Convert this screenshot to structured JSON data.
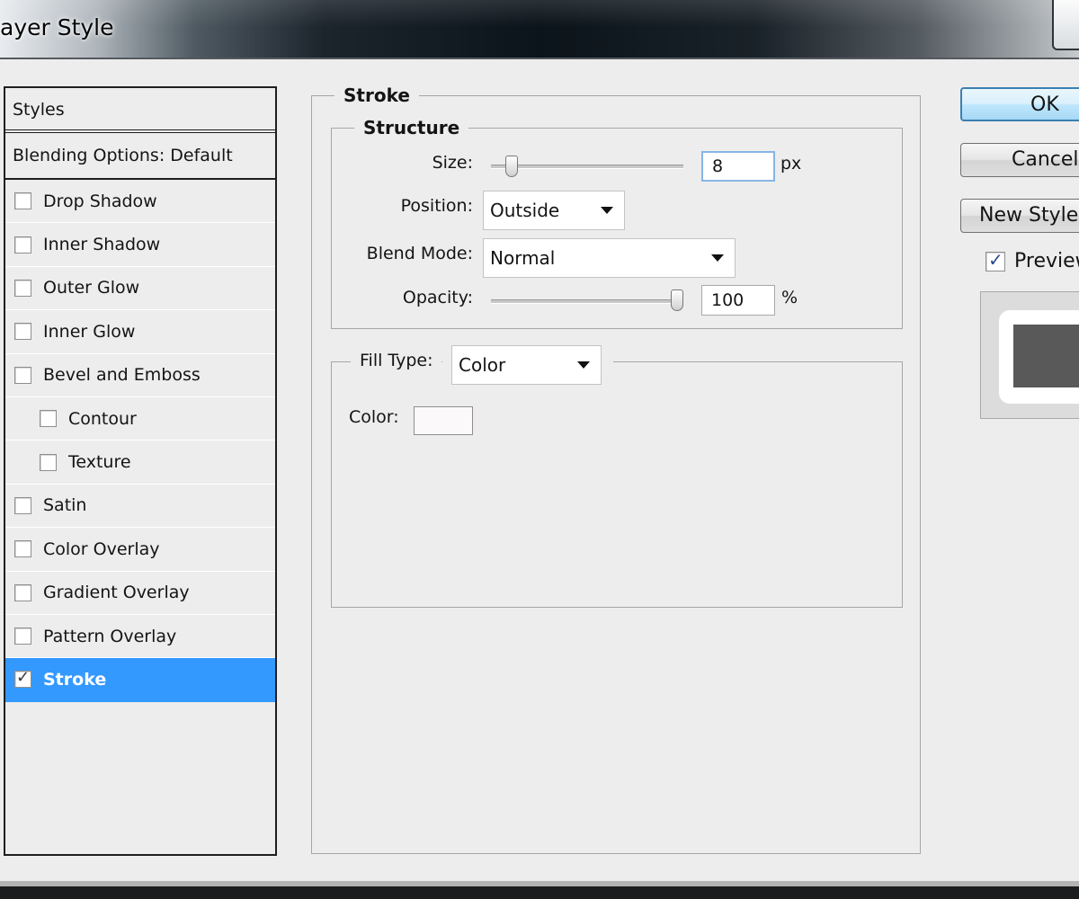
{
  "window": {
    "title": "ayer Style"
  },
  "styles_panel": {
    "header": "Styles",
    "blending_options": "Blending Options: Default",
    "items": [
      {
        "label": "Drop Shadow",
        "checked": false,
        "indent": false,
        "selected": false
      },
      {
        "label": "Inner Shadow",
        "checked": false,
        "indent": false,
        "selected": false
      },
      {
        "label": "Outer Glow",
        "checked": false,
        "indent": false,
        "selected": false
      },
      {
        "label": "Inner Glow",
        "checked": false,
        "indent": false,
        "selected": false
      },
      {
        "label": "Bevel and Emboss",
        "checked": false,
        "indent": false,
        "selected": false
      },
      {
        "label": "Contour",
        "checked": false,
        "indent": true,
        "selected": false
      },
      {
        "label": "Texture",
        "checked": false,
        "indent": true,
        "selected": false
      },
      {
        "label": "Satin",
        "checked": false,
        "indent": false,
        "selected": false
      },
      {
        "label": "Color Overlay",
        "checked": false,
        "indent": false,
        "selected": false
      },
      {
        "label": "Gradient Overlay",
        "checked": false,
        "indent": false,
        "selected": false
      },
      {
        "label": "Pattern Overlay",
        "checked": false,
        "indent": false,
        "selected": false
      },
      {
        "label": "Stroke",
        "checked": true,
        "indent": false,
        "selected": true
      }
    ]
  },
  "stroke": {
    "title": "Stroke",
    "structure": {
      "title": "Structure",
      "size_label": "Size:",
      "size_value": "8",
      "size_unit": "px",
      "size_slider_fraction": 0.08,
      "position_label": "Position:",
      "position_value": "Outside",
      "blend_mode_label": "Blend Mode:",
      "blend_mode_value": "Normal",
      "opacity_label": "Opacity:",
      "opacity_value": "100",
      "opacity_unit": "%",
      "opacity_slider_fraction": 1.0
    },
    "fill": {
      "fill_type_label": "Fill Type:",
      "fill_type_value": "Color",
      "color_label": "Color:",
      "color_value": "#fcf9fa"
    }
  },
  "buttons": {
    "ok": "OK",
    "cancel": "Cancel",
    "new_style": "New Style...",
    "preview": "Preview"
  },
  "colors": {
    "selection": "#3399ff",
    "preview_fill": "#595959"
  }
}
